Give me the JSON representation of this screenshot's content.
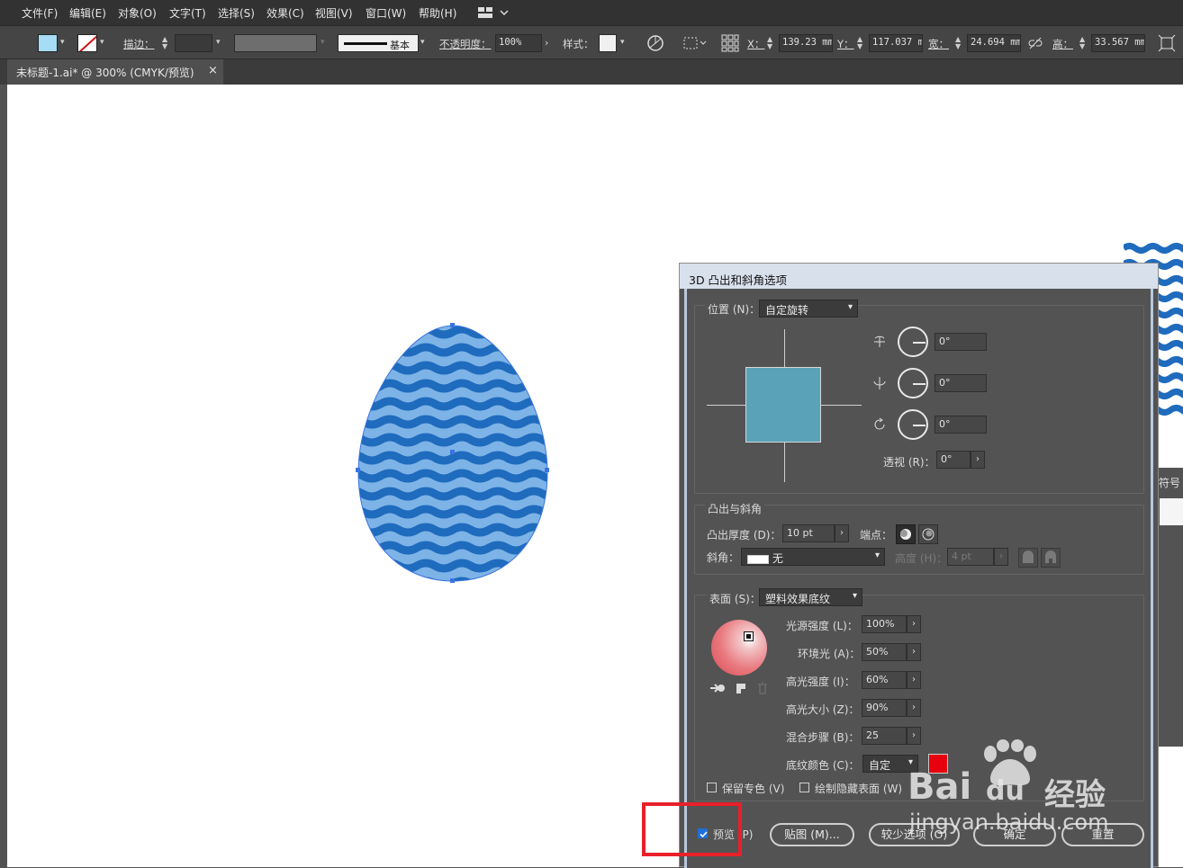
{
  "menubar": {
    "items": [
      "文件(F)",
      "编辑(E)",
      "对象(O)",
      "文字(T)",
      "选择(S)",
      "效果(C)",
      "视图(V)",
      "窗口(W)",
      "帮助(H)"
    ]
  },
  "control_bar": {
    "stroke_label": "描边：",
    "stroke_profile": "基本",
    "opacity_label": "不透明度：",
    "opacity_value": "100%",
    "style_label": "样式：",
    "x_label": "X：",
    "x_value": "139.23 mm",
    "y_label": "Y：",
    "y_value": "117.037 m",
    "w_label": "宽：",
    "w_value": "24.694 mm",
    "h_label": "高：",
    "h_value": "33.567 mm",
    "fill_color": "#a6dcf6",
    "stroke_none_color": "#d01010"
  },
  "document": {
    "tab_title": "未标题-1.ai* @ 300% (CMYK/预览)",
    "close_glyph": "×"
  },
  "artwork": {
    "egg_light": "#7db3e6",
    "egg_dark": "#1f6bbd",
    "selection_color": "#3b74e0"
  },
  "right_panel": {
    "partial_label": "符号"
  },
  "dialog": {
    "title": "3D 凸出和斜角选项",
    "position_label": "位置 (N)：",
    "position_value": "自定旋转",
    "rot_x": "0°",
    "rot_y": "0°",
    "rot_z": "0°",
    "perspective_label": "透视 (R)：",
    "perspective_value": "0°",
    "extrude_section": "凸出与斜角",
    "extrude_depth_label": "凸出厚度 (D)：",
    "extrude_depth_value": "10 pt",
    "cap_label": "端点：",
    "bevel_label": "斜角：",
    "bevel_value": "无",
    "height_label": "高度 (H)：",
    "height_value": "4 pt",
    "surface_label": "表面 (S)：",
    "surface_value": "塑料效果底纹",
    "light_intensity_label": "光源强度 (L)：",
    "light_intensity_value": "100%",
    "ambient_label": "环境光 (A)：",
    "ambient_value": "50%",
    "highlight_intensity_label": "高光强度 (I)：",
    "highlight_intensity_value": "60%",
    "highlight_size_label": "高光大小 (Z)：",
    "highlight_size_value": "90%",
    "blend_steps_label": "混合步骤 (B)：",
    "blend_steps_value": "25",
    "shading_color_label": "底纹颜色 (C)：",
    "shading_color_value": "自定",
    "shading_swatch": "#e8000f",
    "preserve_spot_label": "保留专色 (V)",
    "draw_hidden_label": "绘制隐藏表面 (W)",
    "preview_label": "预览 (P)",
    "map_button": "贴图 (M)...",
    "fewer_options_button": "较少选项 (O)",
    "ok_button": "确定",
    "reset_button": "重置",
    "cube_color": "#5aa2b8"
  },
  "annotation": {
    "highlight_color": "#e8202a"
  },
  "watermark": {
    "brand_a": "Bai",
    "brand_b": "du",
    "brand_c": "经验",
    "url": "jingyan.baidu.com"
  }
}
